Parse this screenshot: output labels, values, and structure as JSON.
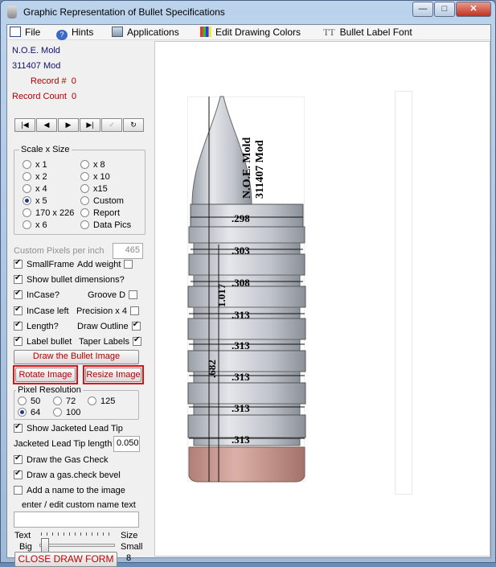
{
  "window": {
    "title": "Graphic Representation of Bullet Specifications",
    "buttons": {
      "minimize": "—",
      "maximize": "□",
      "close": "✕"
    }
  },
  "menu": {
    "file": "File",
    "hints": "Hints",
    "applications": "Applications",
    "edit_colors": "Edit Drawing Colors",
    "label_font_icon": "TT",
    "label_font": "Bullet Label Font"
  },
  "panel": {
    "maker": "N.O.E. Mold",
    "model": "311407 Mod",
    "record_label": "Record #",
    "record_value": "0",
    "count_label": "Record Count",
    "count_value": "0",
    "nav": [
      "|◀",
      "◀",
      "▶",
      "▶|",
      "✓",
      "↻"
    ],
    "scale": {
      "title": "Scale x Size",
      "options": [
        {
          "label": "x 1",
          "selected": false
        },
        {
          "label": "x 8",
          "selected": false
        },
        {
          "label": "x 2",
          "selected": false
        },
        {
          "label": "x 10",
          "selected": false
        },
        {
          "label": "x 4",
          "selected": false
        },
        {
          "label": "x15",
          "selected": false
        },
        {
          "label": "x 5",
          "selected": true
        },
        {
          "label": "Custom",
          "selected": false
        },
        {
          "label": "170 x 226",
          "selected": false
        },
        {
          "label": "Report",
          "selected": false
        },
        {
          "label": "x 6",
          "selected": false
        },
        {
          "label": "Data Pics",
          "selected": false
        }
      ]
    },
    "custom_pixels_label": "Custom Pixels per inch",
    "custom_pixels_value": "465",
    "checks": {
      "small_frame": {
        "label": "SmallFrame",
        "checked": true
      },
      "add_weight": {
        "label": "Add weight",
        "checked": false
      },
      "show_dims": {
        "label": "Show bullet dimensions?",
        "checked": true
      },
      "in_case": {
        "label": "InCase?",
        "checked": true
      },
      "groove_d": {
        "label": "Groove D",
        "checked": false
      },
      "in_case_left": {
        "label": "InCase left",
        "checked": true
      },
      "precision": {
        "label": "Precision x 4",
        "checked": false
      },
      "length": {
        "label": "Length?",
        "checked": true
      },
      "draw_outline": {
        "label": "Draw Outline",
        "checked": true
      },
      "label_bullet": {
        "label": "Label bullet",
        "checked": true
      },
      "taper_labels": {
        "label": "Taper Labels",
        "checked": true
      }
    },
    "draw_button": "Draw the Bullet Image",
    "rotate_button": "Rotate Image",
    "resize_button": "Resize Image",
    "resolution": {
      "title": "Pixel Resolution",
      "options": [
        {
          "label": "50",
          "selected": false
        },
        {
          "label": "72",
          "selected": false
        },
        {
          "label": "125",
          "selected": false
        },
        {
          "label": "64",
          "selected": true
        },
        {
          "label": "100",
          "selected": false
        }
      ]
    },
    "show_jacketed": {
      "label": "Show Jacketed Lead Tip",
      "checked": true
    },
    "jacketed_length_label": "Jacketed Lead Tip length",
    "jacketed_length_value": "0.050",
    "gas_check": {
      "label": "Draw the Gas Check",
      "checked": true
    },
    "gas_bevel": {
      "label": "Draw a gas.check bevel",
      "checked": true
    },
    "add_name": {
      "label": "Add a name to the image",
      "checked": false
    },
    "custom_name_label": "enter / edit custom name text",
    "custom_name_value": "",
    "text_label": "Text",
    "size_label": "Size",
    "big_label": "Big",
    "small_label": "Small",
    "size_value": "8",
    "close_button": "CLOSE DRAW FORM"
  },
  "bullet": {
    "name_line1": "N.O.E. Mold",
    "name_line2": "311407 Mod",
    "dims": [
      ".298",
      ".303",
      ".308",
      ".313",
      ".313",
      ".313",
      ".313",
      ".313"
    ],
    "length": "1.017",
    "shank": ".682",
    "colors": {
      "body": "#b8bcc4",
      "gas_check": "#c9958c"
    }
  }
}
